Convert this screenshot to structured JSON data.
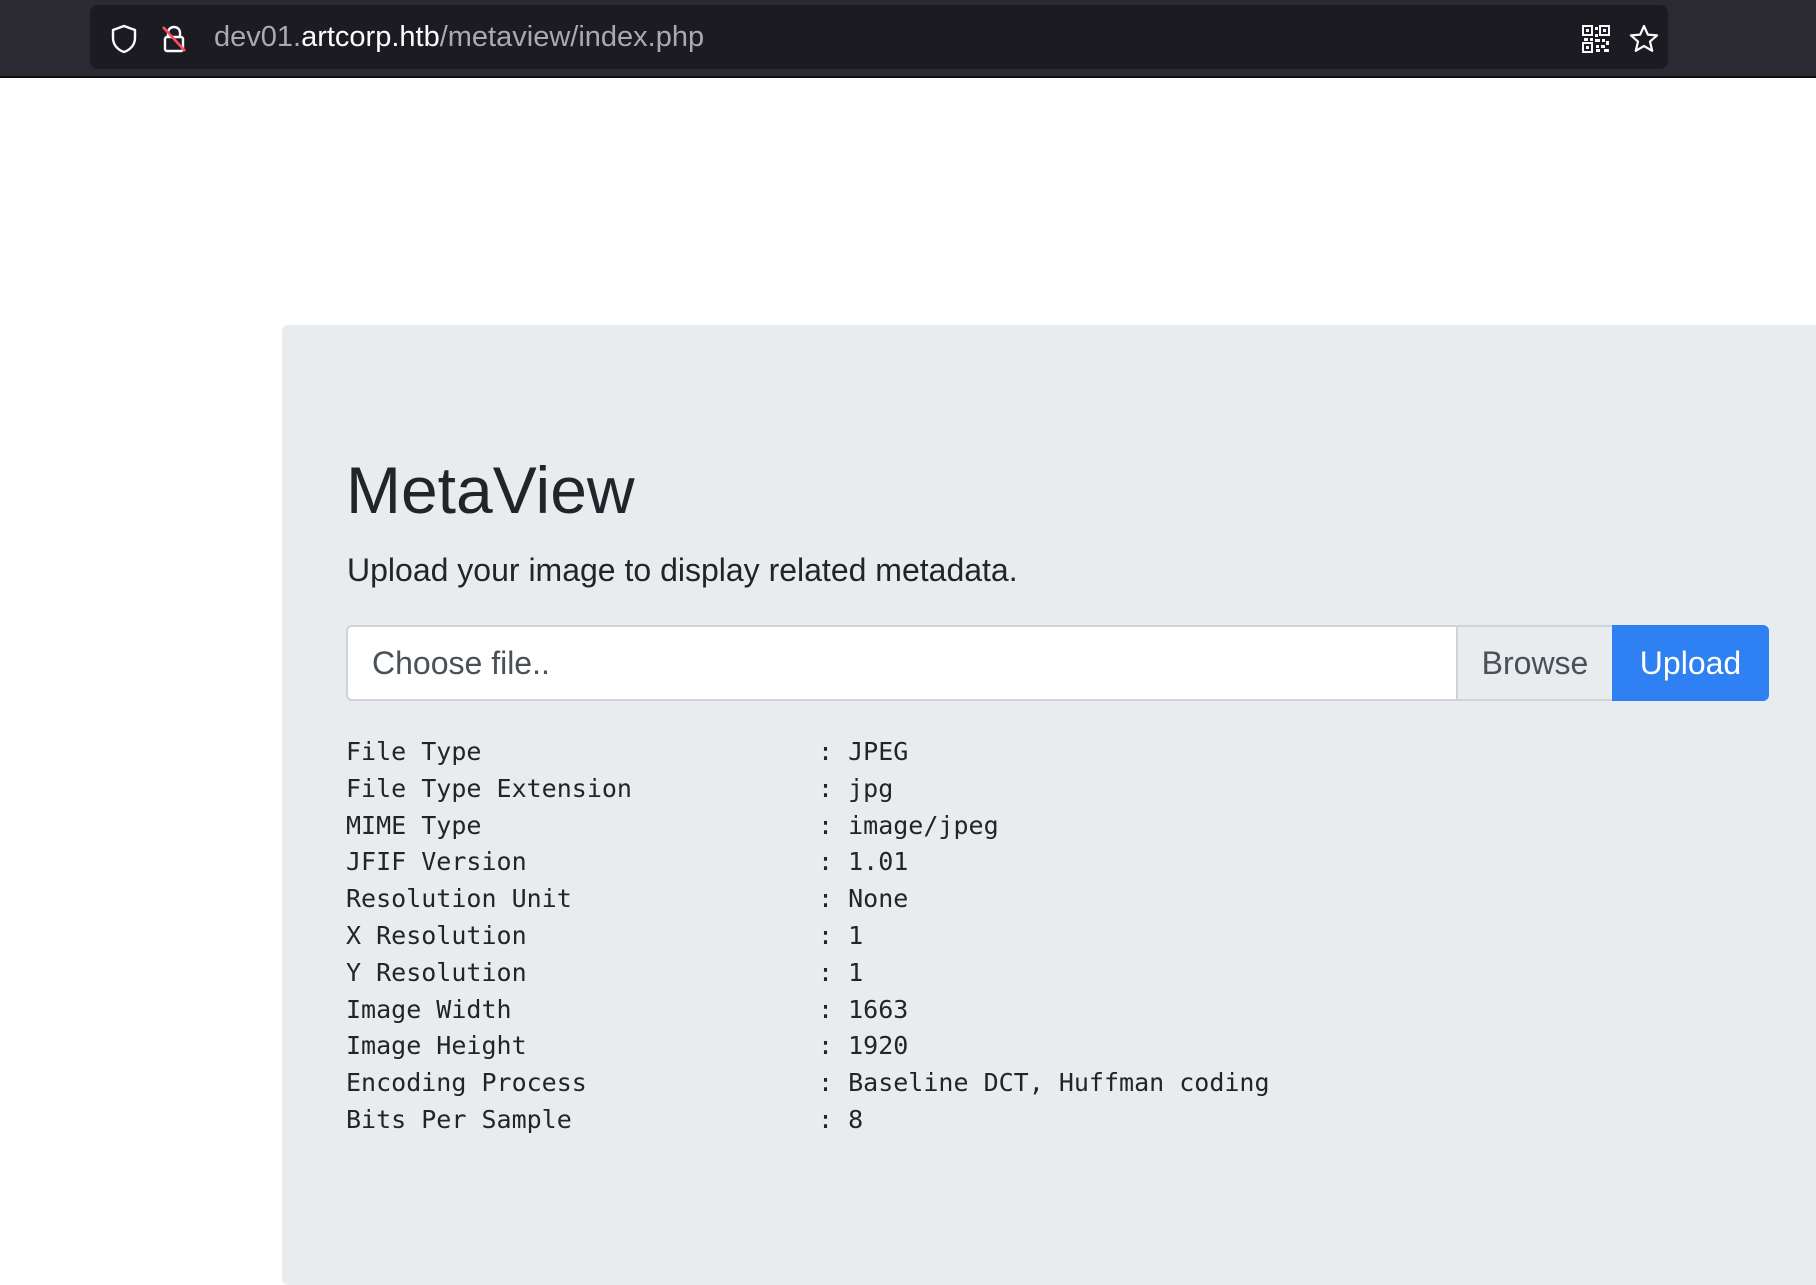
{
  "browser": {
    "url_prefix": "dev01.",
    "url_host": "artcorp.htb",
    "url_path": "/metaview/index.php"
  },
  "page": {
    "title": "MetaView",
    "lead": "Upload your image to display related metadata."
  },
  "upload": {
    "placeholder": "Choose file..",
    "browse_label": "Browse",
    "upload_label": "Upload"
  },
  "metadata": [
    {
      "key": "File Type",
      "value": ": JPEG"
    },
    {
      "key": "File Type Extension",
      "value": ": jpg"
    },
    {
      "key": "MIME Type",
      "value": ": image/jpeg"
    },
    {
      "key": "JFIF Version",
      "value": ": 1.01"
    },
    {
      "key": "Resolution Unit",
      "value": ": None"
    },
    {
      "key": "X Resolution",
      "value": ": 1"
    },
    {
      "key": "Y Resolution",
      "value": ": 1"
    },
    {
      "key": "Image Width",
      "value": ": 1663"
    },
    {
      "key": "Image Height",
      "value": ": 1920"
    },
    {
      "key": "Encoding Process",
      "value": ": Baseline DCT, Huffman coding"
    },
    {
      "key": "Bits Per Sample",
      "value": ": 8"
    }
  ],
  "colors": {
    "toolbar": "#2b2a33",
    "urlbar": "#1c1b22",
    "panel": "#e9ecef",
    "accent": "#2f80f2"
  },
  "icons": [
    "shield-icon",
    "insecure-lock-icon",
    "qr-code-icon",
    "bookmark-star-icon"
  ]
}
